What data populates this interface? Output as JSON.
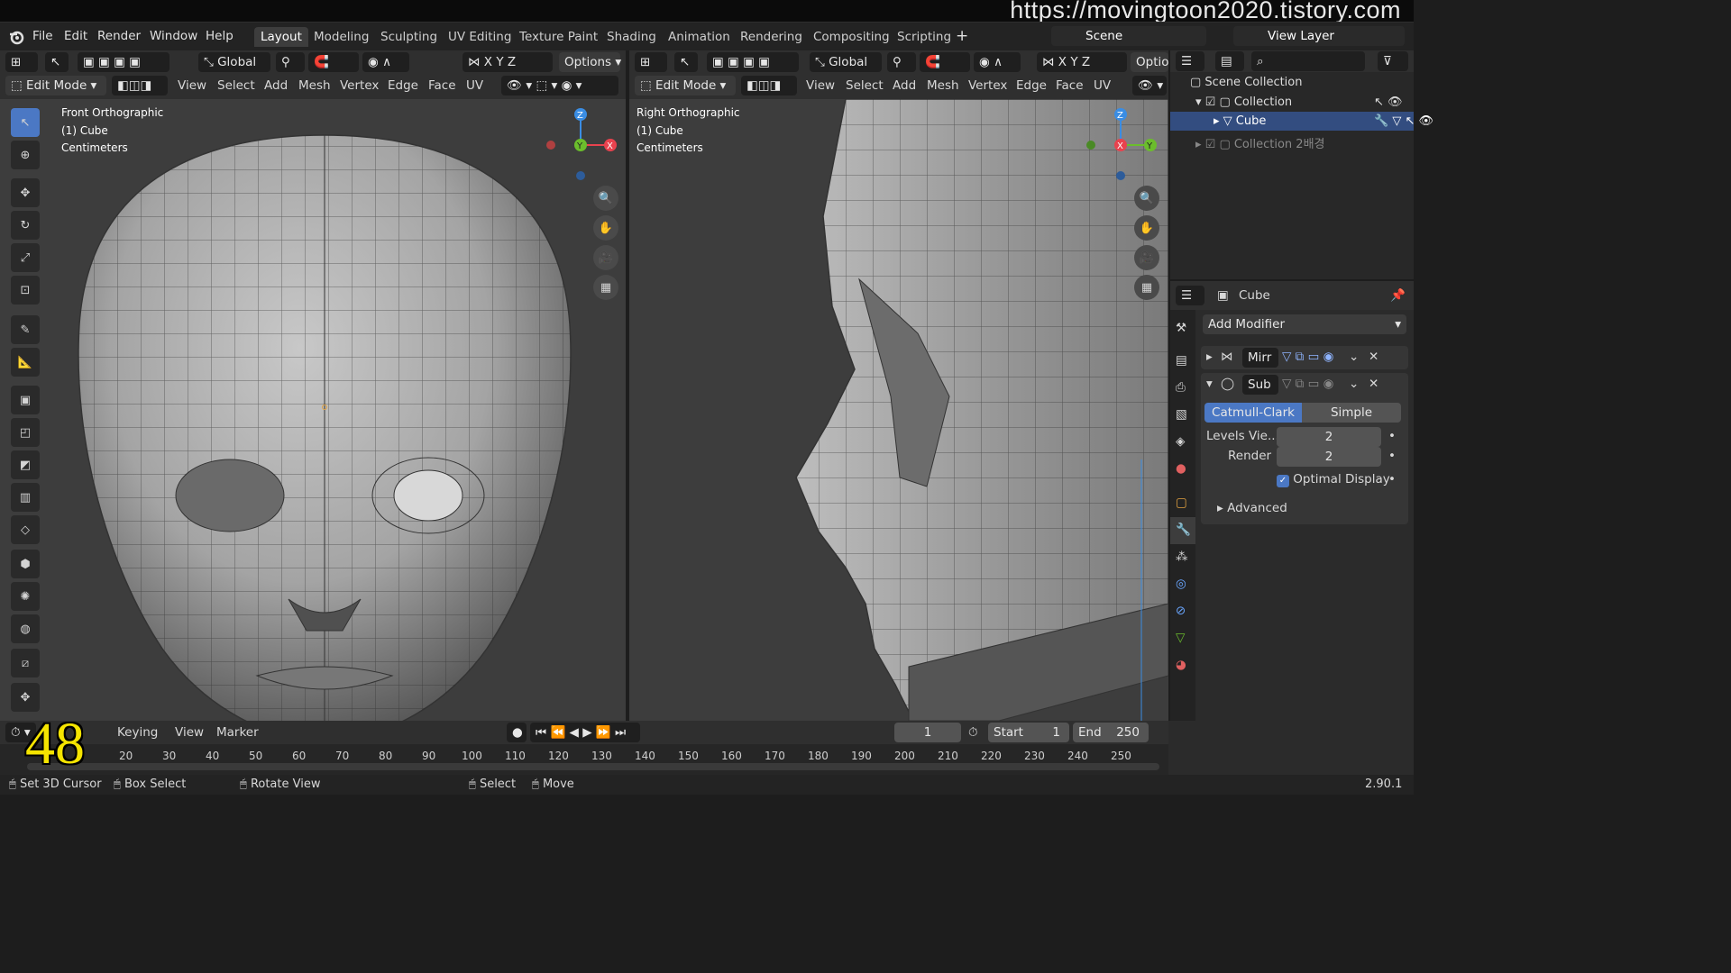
{
  "watermark": "https://movingtoon2020.tistory.com",
  "menu": [
    "File",
    "Edit",
    "Render",
    "Window",
    "Help"
  ],
  "workspaces": [
    "Layout",
    "Modeling",
    "Sculpting",
    "UV Editing",
    "Texture Paint",
    "Shading",
    "Animation",
    "Rendering",
    "Compositing",
    "Scripting"
  ],
  "active_workspace": "Layout",
  "scene_name": "Scene",
  "view_layer": "View Layer",
  "viewport_left": {
    "orientation": "Global",
    "options": "Options",
    "mode": "Edit Mode",
    "menus": [
      "View",
      "Select",
      "Add",
      "Mesh",
      "Vertex",
      "Edge",
      "Face",
      "UV"
    ],
    "axes": [
      "X",
      "Y",
      "Z"
    ],
    "overlay": [
      "Front Orthographic",
      "(1) Cube",
      "Centimeters"
    ]
  },
  "viewport_right": {
    "orientation": "Global",
    "options": "Optio",
    "mode": "Edit Mode",
    "menus": [
      "View",
      "Select",
      "Add",
      "Mesh",
      "Vertex",
      "Edge",
      "Face",
      "UV"
    ],
    "axes": [
      "X",
      "Y",
      "Z"
    ],
    "overlay": [
      "Right Orthographic",
      "(1) Cube",
      "Centimeters"
    ]
  },
  "outliner": {
    "items": [
      {
        "label": "Scene Collection"
      },
      {
        "label": "Collection"
      },
      {
        "label": "Cube"
      },
      {
        "label": "Collection 2배경"
      }
    ]
  },
  "properties": {
    "object": "Cube",
    "add_modifier": "Add Modifier",
    "mod1": "Mirr",
    "mod2": "Sub",
    "tab_catmull": "Catmull-Clark",
    "tab_simple": "Simple",
    "levels_label": "Levels Vie...",
    "levels_value": "2",
    "render_label": "Render",
    "render_value": "2",
    "optimal": "Optimal Display",
    "advanced": "Advanced"
  },
  "timeline": {
    "menus": [
      "Keying",
      "View",
      "Marker"
    ],
    "frame": "1",
    "start_label": "Start",
    "start": "1",
    "end_label": "End",
    "end": "250",
    "ticks": [
      "20",
      "30",
      "40",
      "50",
      "60",
      "70",
      "80",
      "90",
      "100",
      "110",
      "120",
      "130",
      "140",
      "150",
      "160",
      "170",
      "180",
      "190",
      "200",
      "210",
      "220",
      "230",
      "240",
      "250"
    ],
    "overlay_number": "48"
  },
  "status": {
    "items": [
      "Set 3D Cursor",
      "Box Select",
      "Rotate View",
      "Select",
      "Move"
    ],
    "version": "2.90.1"
  },
  "colors": {
    "accent": "#4b78c4",
    "x_axis": "#e8424e",
    "y_axis": "#6bbd2c",
    "z_axis": "#3a8de4"
  }
}
